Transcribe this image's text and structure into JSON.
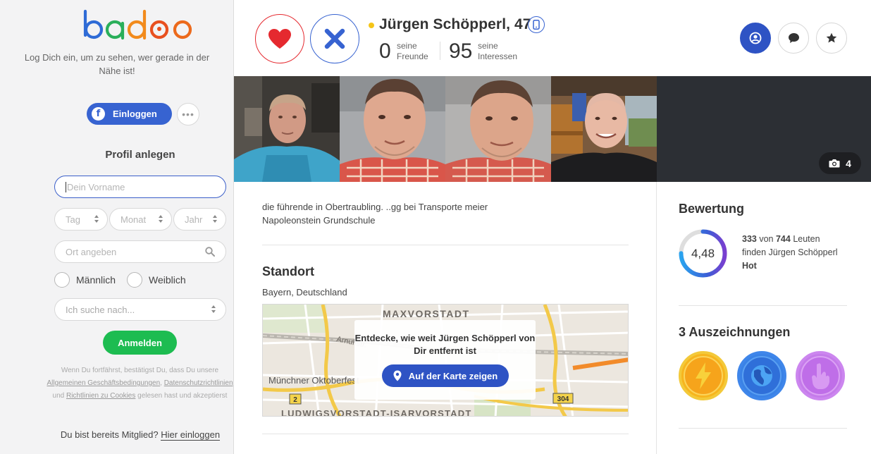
{
  "brand": {
    "logo_text": "badoo"
  },
  "sidebar": {
    "tagline": "Log Dich ein, um zu sehen, wer gerade in der Nähe ist!",
    "fb_login_label": "Einloggen",
    "fb_icon_glyph": "f",
    "more_glyph": "•••",
    "create_profile_title": "Profil anlegen",
    "first_name_placeholder": "Dein Vorname",
    "day_placeholder": "Tag",
    "month_placeholder": "Monat",
    "year_placeholder": "Jahr",
    "location_placeholder": "Ort angeben",
    "gender_male": "Männlich",
    "gender_female": "Weiblich",
    "looking_for_placeholder": "Ich suche nach...",
    "submit_label": "Anmelden",
    "legal": {
      "part1": "Wenn Du fortfährst, bestätigst Du, dass Du unsere",
      "terms_link": "Allgemeinen Geschäftsbedingungen",
      "separator": ",",
      "privacy_link": "Datenschutzrichtlinien",
      "and": "und",
      "cookies_link": "Richtlinien zu Cookies",
      "part2": "gelesen hast und akzeptierst"
    },
    "member_question": "Du bist bereits Mitglied?",
    "member_login_link": "Hier einloggen"
  },
  "profile": {
    "name_age": "Jürgen Schöpperl, 47",
    "friends_count": "0",
    "friends_label_1": "seine",
    "friends_label_2": "Freunde",
    "interests_count": "95",
    "interests_label_1": "seine",
    "interests_label_2": "Interessen",
    "photo_count": "4",
    "about_text": "die führende in Obertraubling. ..gg bei Transporte meier Napoleonstein Grundschule"
  },
  "location": {
    "title": "Standort",
    "text": "Bayern, Deutschland",
    "map_labels": {
      "district1": "MAXVORSTADT",
      "district2": "LUDWIGSVORSTADT-ISARVORSTADT",
      "street": "Arnulfstr.",
      "place": "Münchner Oktoberfest",
      "road1": "2",
      "road2": "304"
    },
    "card_text": "Entdecke, wie weit Jürgen Schöpperl von Dir entfernt ist",
    "map_button": "Auf der Karte zeigen"
  },
  "rating": {
    "title": "Bewertung",
    "score": "4,48",
    "score_fraction": 0.75,
    "count": "333",
    "of": "von",
    "total": "744",
    "people": "Leuten",
    "find_text": "finden Jürgen Schöpperl",
    "verdict": "Hot"
  },
  "awards": {
    "title": "3 Auszeichnungen",
    "items": [
      "lightning-badge-icon",
      "globe-badge-icon",
      "hand-badge-icon"
    ]
  },
  "colors": {
    "accent_blue": "#2e53c4",
    "like_red": "#e5292f",
    "cta_green": "#1dbc51",
    "online_yellow": "#f5c518"
  }
}
